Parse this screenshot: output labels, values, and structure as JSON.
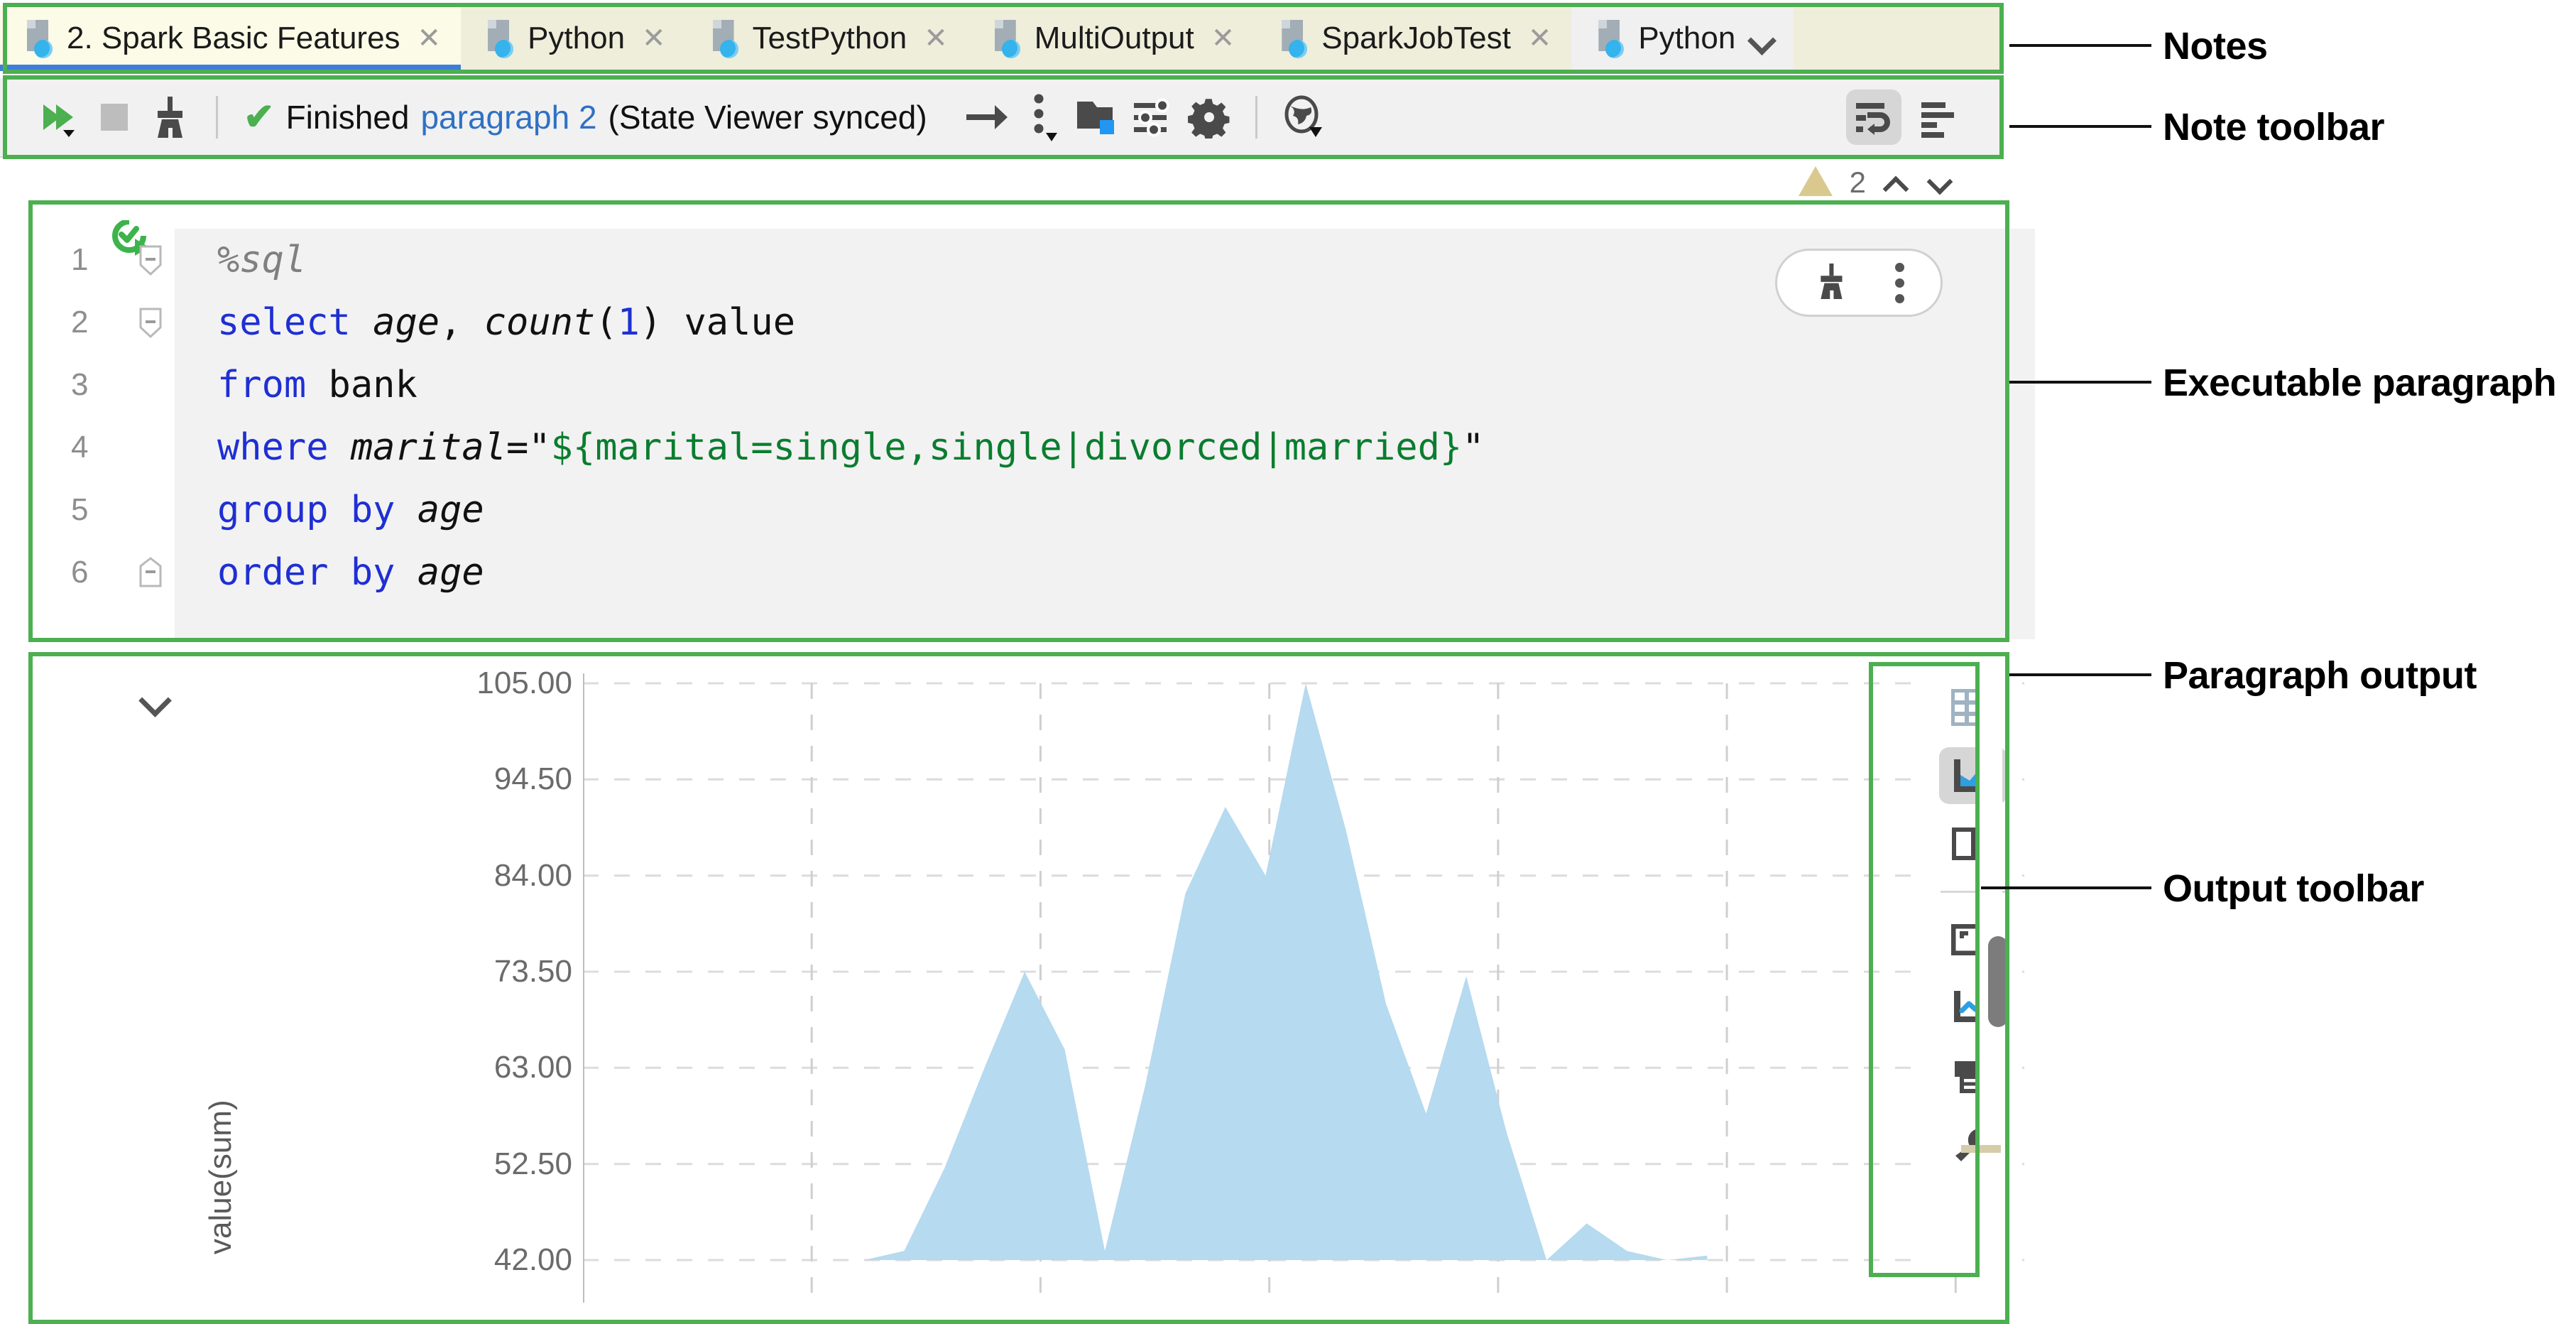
{
  "tabs": [
    {
      "label": "2. Spark Basic Features",
      "active": true,
      "close": "✕",
      "clipped": false
    },
    {
      "label": "Python",
      "active": false,
      "close": "✕",
      "clipped": false
    },
    {
      "label": "TestPython",
      "active": false,
      "close": "✕",
      "clipped": false
    },
    {
      "label": "MultiOutput",
      "active": false,
      "close": "✕",
      "clipped": false
    },
    {
      "label": "SparkJobTest",
      "active": false,
      "close": "✕",
      "clipped": false
    },
    {
      "label": "Python",
      "active": false,
      "close": "",
      "clipped": true
    }
  ],
  "note_toolbar": {
    "run_all": "run-all-icon",
    "stop": "stop-icon",
    "clear_output": "broom-icon",
    "status_check": "✔",
    "status_text": "Finished",
    "status_link": "paragraph 2",
    "status_sub": "(State Viewer synced)",
    "arrow": "arrow-right-icon",
    "kebab": "more-vertical-icon",
    "folder": "folder-icon",
    "sliders": "sliders-icon",
    "gear": "gear-icon",
    "globe": "globe-icon",
    "wrap": "text-wrap-icon",
    "align": "text-align-icon"
  },
  "warnings": {
    "icon": "warning-triangle-icon",
    "count": "2",
    "prev": "chevron-up-icon",
    "next": "chevron-down-icon"
  },
  "paragraph": {
    "run_icon": "run-paragraph-icon",
    "actions": {
      "clear": "broom-icon",
      "menu": "more-vertical-icon"
    },
    "lines": [
      {
        "n": "1",
        "fold": "start",
        "tokens": [
          {
            "t": "%sql",
            "c": "com"
          }
        ]
      },
      {
        "n": "2",
        "fold": "start",
        "tokens": [
          {
            "t": "select ",
            "c": "kw"
          },
          {
            "t": "age",
            "c": "id"
          },
          {
            "t": ", ",
            "c": "plain"
          },
          {
            "t": "count",
            "c": "id"
          },
          {
            "t": "(",
            "c": "plain"
          },
          {
            "t": "1",
            "c": "num"
          },
          {
            "t": ") value",
            "c": "plain"
          }
        ]
      },
      {
        "n": "3",
        "fold": "none",
        "tokens": [
          {
            "t": "from ",
            "c": "kw"
          },
          {
            "t": "bank",
            "c": "plain"
          }
        ]
      },
      {
        "n": "4",
        "fold": "none",
        "tokens": [
          {
            "t": "where ",
            "c": "kw"
          },
          {
            "t": "marital",
            "c": "id"
          },
          {
            "t": "=\"",
            "c": "plain"
          },
          {
            "t": "${marital=single,single|divorced|married}",
            "c": "str"
          },
          {
            "t": "\"",
            "c": "plain"
          }
        ]
      },
      {
        "n": "5",
        "fold": "none",
        "tokens": [
          {
            "t": "group by ",
            "c": "kw"
          },
          {
            "t": "age",
            "c": "id"
          }
        ]
      },
      {
        "n": "6",
        "fold": "end",
        "tokens": [
          {
            "t": "order by ",
            "c": "kw"
          },
          {
            "t": "age",
            "c": "id"
          }
        ]
      }
    ]
  },
  "output": {
    "collapse": "chevron-down-icon",
    "toolbar": [
      {
        "name": "table-view-icon",
        "selected": false
      },
      {
        "name": "area-chart-icon",
        "selected": true
      },
      {
        "name": "split-view-icon",
        "selected": false
      },
      {
        "name": "divider",
        "selected": false
      },
      {
        "name": "fullscreen-icon",
        "selected": false
      },
      {
        "name": "line-chart-icon",
        "selected": false
      },
      {
        "name": "save-icon",
        "selected": false
      },
      {
        "name": "wrench-icon",
        "selected": false
      }
    ]
  },
  "chart_data": {
    "type": "area",
    "title": "",
    "xlabel": "",
    "ylabel": "value(sum)",
    "ytick_labels": [
      "105.00",
      "94.50",
      "84.00",
      "73.50",
      "63.00",
      "52.50",
      "42.00"
    ],
    "ylim": [
      42.0,
      105.0
    ],
    "grid": true,
    "legend": false,
    "series_color": "#b6daef",
    "x": [
      0,
      1,
      2,
      3,
      4,
      5,
      6,
      7,
      8,
      9,
      10,
      11,
      12,
      13,
      14,
      15,
      16,
      17,
      18,
      19,
      20,
      21,
      22,
      23,
      24,
      25,
      26,
      27,
      28
    ],
    "values": [
      42.0,
      42.0,
      42.0,
      42.0,
      42.0,
      42.0,
      42.0,
      42.0,
      43.0,
      52.0,
      63.0,
      73.5,
      65.0,
      43.0,
      61.0,
      82.0,
      91.5,
      84.0,
      105.0,
      89.0,
      70.0,
      58.0,
      73.0,
      56.0,
      42.0,
      46.0,
      43.0,
      42.0,
      42.5
    ]
  },
  "annotations": [
    {
      "label": "Notes"
    },
    {
      "label": "Note toolbar"
    },
    {
      "label": "Executable paragraph"
    },
    {
      "label": "Paragraph output"
    },
    {
      "label": "Output toolbar"
    }
  ]
}
